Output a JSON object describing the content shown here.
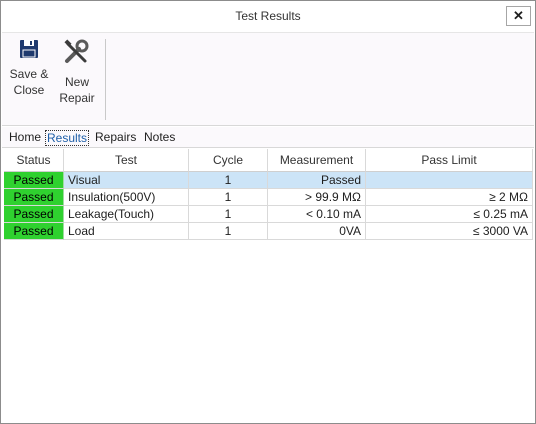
{
  "window": {
    "title": "Test Results",
    "close_label": "✕"
  },
  "ribbon": {
    "save_close_label": "Save &\nClose",
    "new_repair_label": "New\nRepair"
  },
  "tabs": [
    "Home",
    "Results",
    "Repairs",
    "Notes"
  ],
  "active_tab": "Results",
  "table": {
    "columns": [
      "Status",
      "Test",
      "Cycle",
      "Measurement",
      "Pass Limit"
    ],
    "rows": [
      {
        "status": "Passed",
        "test": "Visual",
        "cycle": "1",
        "measurement": "Passed",
        "pass_limit": "",
        "selected": true
      },
      {
        "status": "Passed",
        "test": "Insulation(500V)",
        "cycle": "1",
        "measurement": "> 99.9 MΩ",
        "pass_limit": "≥ 2 MΩ",
        "selected": false
      },
      {
        "status": "Passed",
        "test": "Leakage(Touch)",
        "cycle": "1",
        "measurement": "< 0.10 mA",
        "pass_limit": "≤ 0.25 mA",
        "selected": false
      },
      {
        "status": "Passed",
        "test": "Load",
        "cycle": "1",
        "measurement": "0VA",
        "pass_limit": "≤ 3000 VA",
        "selected": false
      }
    ]
  },
  "colors": {
    "passed": "#2fd12f",
    "selected_row": "#cce4f7",
    "active_tab": "#1e5fa8"
  }
}
